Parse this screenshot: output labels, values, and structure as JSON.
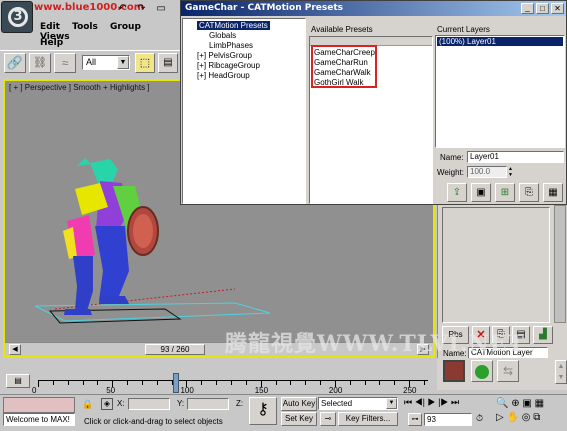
{
  "app_logo_text": "3",
  "watermark_top": "www.blue1000.com",
  "menu": {
    "items": [
      "Edit",
      "Tools",
      "Group",
      "Views"
    ],
    "help": "Help"
  },
  "toolbar": {
    "select_filter": "All"
  },
  "viewport": {
    "label": "[ + ] Perspective ] Smooth + Highlights ]"
  },
  "dialog": {
    "title": "GameChar - CATMotion Presets",
    "tree": [
      {
        "label": "CATMotion Presets",
        "indent": 0,
        "expander": "",
        "selected": true
      },
      {
        "label": "Globals",
        "indent": 1,
        "expander": "",
        "selected": false
      },
      {
        "label": "LimbPhases",
        "indent": 1,
        "expander": "",
        "selected": false
      },
      {
        "label": "PelvisGroup",
        "indent": 1,
        "expander": "[+]",
        "selected": false
      },
      {
        "label": "RibcageGroup",
        "indent": 1,
        "expander": "[+]",
        "selected": false
      },
      {
        "label": "HeadGroup",
        "indent": 1,
        "expander": "[+]",
        "selected": false
      }
    ],
    "presets_header": "Available Presets",
    "presets": [
      "GameCharCreep",
      "GameCharRun",
      "GameCharWalk",
      "GothGirl Walk"
    ],
    "layers_header": "Current Layers",
    "layers": [
      "(100%) Layer01"
    ],
    "name_label": "Name:",
    "name_value": "Layer01",
    "weight_label": "Weight:",
    "weight_value": "100.0"
  },
  "panel": {
    "rbs_label": "Rbs",
    "name_label": "Name:",
    "name_value": "CATMotion Layer"
  },
  "timeline": {
    "slider_label": "93 / 260",
    "ticks": [
      0,
      50,
      100,
      150,
      200,
      250
    ],
    "range_max": 260,
    "current_frame": 93
  },
  "watermark_bottom": "腾龍視覺WWW.TLVI.NET",
  "status": {
    "maxscript": "Welcome to MAX!",
    "prompt": "Click or click-and-drag to select objects",
    "x_label": "X:",
    "y_label": "Y:",
    "z_label": "Z:",
    "auto_key": "Auto Key",
    "set_key": "Set Key",
    "selected": "Selected",
    "key_filters": "Key Filters...",
    "frame_value": "93"
  },
  "colors": {
    "viewport_border": "#e6e600",
    "title_bar": "#0a246a",
    "highlight_box": "#e02020",
    "selection": "#0a246a"
  }
}
